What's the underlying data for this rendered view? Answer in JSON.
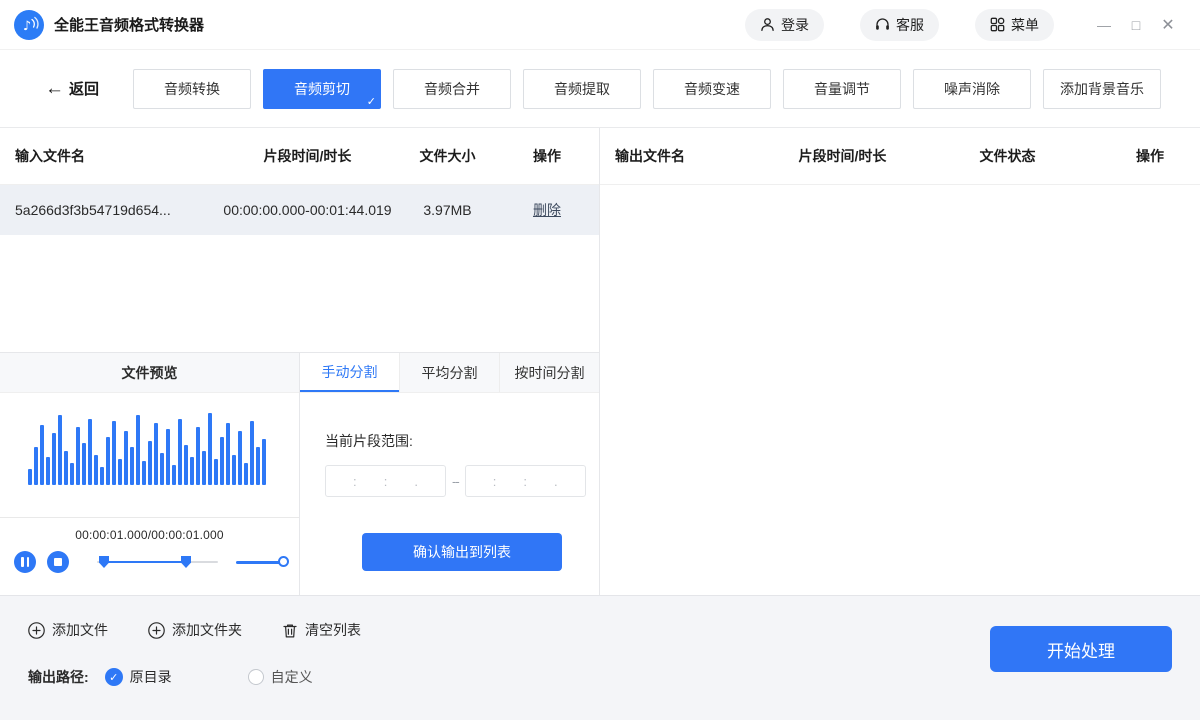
{
  "titlebar": {
    "app_title": "全能王音频格式转换器",
    "login": "登录",
    "service": "客服",
    "menu": "菜单",
    "minimize_glyph": "—",
    "maximize_glyph": "□",
    "close_glyph": "✕"
  },
  "nav": {
    "back": "返回",
    "tabs": [
      {
        "label": "音频转换",
        "active": false
      },
      {
        "label": "音频剪切",
        "active": true
      },
      {
        "label": "音频合并",
        "active": false
      },
      {
        "label": "音频提取",
        "active": false
      },
      {
        "label": "音频变速",
        "active": false
      },
      {
        "label": "音量调节",
        "active": false
      },
      {
        "label": "噪声消除",
        "active": false
      },
      {
        "label": "添加背景音乐",
        "active": false
      }
    ],
    "active_check": "✓"
  },
  "input_table": {
    "headers": [
      "输入文件名",
      "片段时间/时长",
      "文件大小",
      "操作"
    ],
    "rows": [
      {
        "name": "5a266d3f3b54719d654...",
        "time": "00:00:00.000-00:01:44.019",
        "size": "3.97MB",
        "action": "删除"
      }
    ]
  },
  "output_table": {
    "headers": [
      "输出文件名",
      "片段时间/时长",
      "文件状态",
      "操作"
    ],
    "rows": []
  },
  "preview": {
    "title": "文件预览",
    "time_display": "00:00:01.000/00:00:01.000"
  },
  "waveform": {
    "bars": [
      16,
      38,
      60,
      28,
      52,
      70,
      34,
      22,
      58,
      42,
      66,
      30,
      18,
      48,
      64,
      26,
      54,
      38,
      70,
      24,
      44,
      62,
      32,
      56,
      20,
      66,
      40,
      28,
      58,
      34,
      72,
      26,
      48,
      62,
      30,
      54,
      22,
      64,
      38,
      46
    ]
  },
  "split": {
    "tabs": [
      {
        "label": "手动分割",
        "active": true
      },
      {
        "label": "平均分割",
        "active": false
      },
      {
        "label": "按时间分割",
        "active": false
      }
    ],
    "range_label": "当前片段范围:",
    "separators": [
      ":",
      ":",
      "."
    ],
    "range_separator": "--",
    "confirm_button": "确认输出到列表"
  },
  "footer": {
    "add_file": "添加文件",
    "add_folder": "添加文件夹",
    "clear_list": "清空列表",
    "output_path_label": "输出路径:",
    "path_options": [
      {
        "label": "原目录",
        "selected": true
      },
      {
        "label": "自定义",
        "selected": false
      }
    ],
    "radio_check": "✓",
    "start_button": "开始处理"
  },
  "colors": {
    "primary": "#3076f6",
    "row_highlight": "#edf0f5"
  }
}
